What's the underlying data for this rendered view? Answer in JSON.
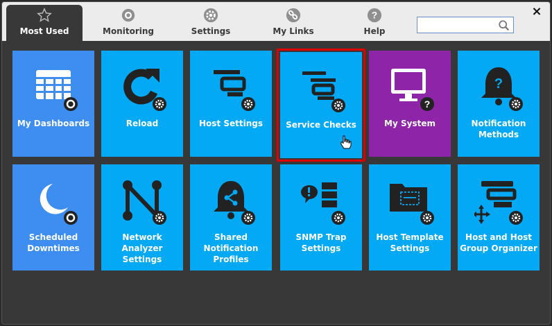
{
  "tabs": [
    {
      "label": "Most Used",
      "icon": "star-icon",
      "active": true
    },
    {
      "label": "Monitoring",
      "icon": "eye-icon"
    },
    {
      "label": "Settings",
      "icon": "gear-icon"
    },
    {
      "label": "My Links",
      "icon": "link-icon"
    },
    {
      "label": "Help",
      "icon": "help-icon"
    }
  ],
  "search": {
    "placeholder": "",
    "value": ""
  },
  "close_label": "×",
  "colors": {
    "tile_blue": "#03a9f4",
    "tile_dash": "#3d8ef0",
    "tile_purple": "#8e24a8",
    "highlight": "#e00000"
  },
  "tiles": [
    {
      "label": "My Dashboards",
      "icon": "dashboard-grid-icon"
    },
    {
      "label": "Reload",
      "icon": "reload-icon"
    },
    {
      "label": "Host Settings",
      "icon": "host-settings-icon"
    },
    {
      "label": "Service Checks",
      "icon": "service-checks-icon",
      "highlighted": true
    },
    {
      "label": "My System",
      "icon": "monitor-icon"
    },
    {
      "label": "Notification Methods",
      "icon": "bell-question-icon"
    },
    {
      "label": "Scheduled Downtimes",
      "icon": "moon-icon"
    },
    {
      "label": "Network Analyzer Settings",
      "icon": "network-icon"
    },
    {
      "label": "Shared Notification Profiles",
      "icon": "bell-share-icon"
    },
    {
      "label": "SNMP Trap Settings",
      "icon": "snmp-icon"
    },
    {
      "label": "Host Template Settings",
      "icon": "folder-template-icon"
    },
    {
      "label": "Host and Host Group Organizer",
      "icon": "organizer-icon"
    }
  ]
}
